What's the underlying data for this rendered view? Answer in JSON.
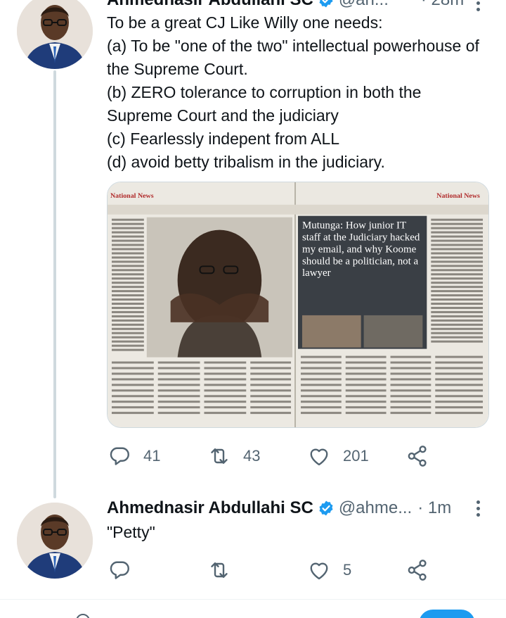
{
  "tweets": [
    {
      "display_name": "Ahmednasir Abdullahi SC",
      "handle": "@ah...",
      "time": "· 28m",
      "text": "To be a great CJ Like Willy one needs:\n(a) To be \"one of the two\" intellectual powerhouse of the Supreme Court.\n(b) ZERO tolerance to corruption in both the Supreme Court and the judiciary\n(c) Fearlessly indepent from ALL\n(d) avoid betty tribalism in the judiciary.",
      "media": {
        "left_page_header": "National News",
        "right_page_header": "National News",
        "headline": "Mutunga: How junior IT staff at the Judiciary hacked my email, and why Koome should be a politician, not a lawyer"
      },
      "replies": "41",
      "retweets": "43",
      "likes": "201"
    },
    {
      "display_name": "Ahmednasir Abdullahi SC",
      "handle": "@ahme...",
      "time": "· 1m",
      "text": "\"Petty\"",
      "replies": "",
      "retweets": "",
      "likes": "5"
    }
  ],
  "icons": {
    "reply": "reply-icon",
    "retweet": "retweet-icon",
    "like": "heart-icon",
    "share": "share-icon",
    "verified": "verified-badge-icon",
    "more": "more-options-icon"
  },
  "colors": {
    "verified_blue": "#1d9bf0",
    "icon_gray": "#536471",
    "text": "#0f1419"
  }
}
